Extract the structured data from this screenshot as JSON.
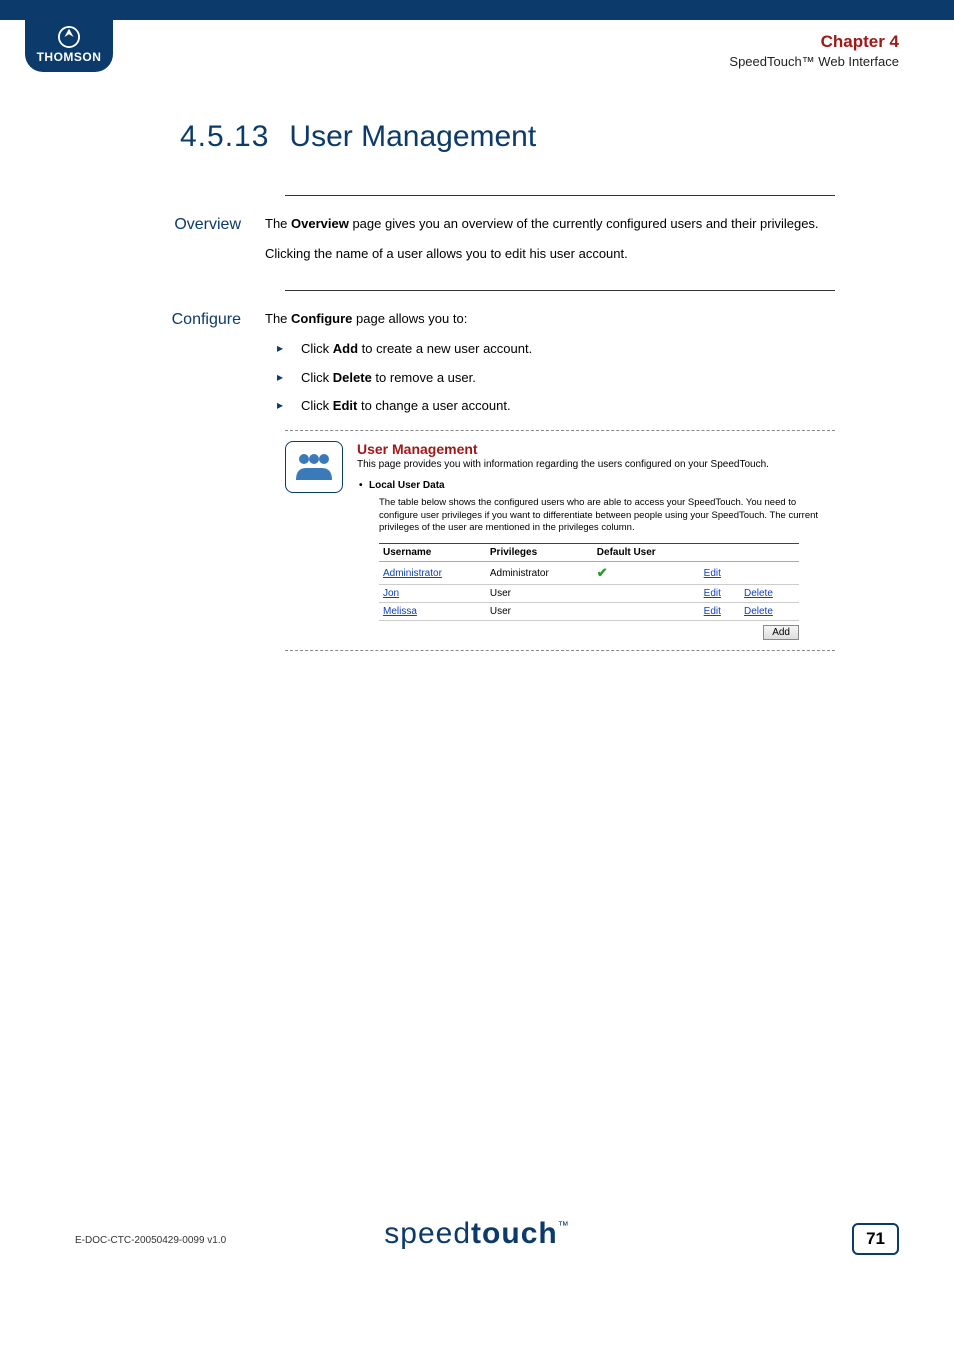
{
  "header": {
    "brand": "THOMSON",
    "chapter": "Chapter 4",
    "subtitle": "SpeedTouch™ Web Interface"
  },
  "title": {
    "number": "4.5.13",
    "text": "User Management"
  },
  "overview": {
    "heading": "Overview",
    "p1a": "The ",
    "p1b": "Overview",
    "p1c": " page gives you an overview of the currently configured users and their privileges.",
    "p2": "Clicking the name of a user allows you to edit his user account."
  },
  "configure": {
    "heading": "Configure",
    "intro_a": "The ",
    "intro_b": "Configure",
    "intro_c": " page allows you to:",
    "items": [
      {
        "pre": "Click ",
        "bold": "Add",
        "post": " to create a new user account."
      },
      {
        "pre": "Click ",
        "bold": "Delete",
        "post": " to remove a user."
      },
      {
        "pre": "Click ",
        "bold": "Edit",
        "post": " to change a user account."
      }
    ]
  },
  "ui": {
    "title": "User Management",
    "desc": "This page provides you with information regarding the users configured on your SpeedTouch.",
    "subhead": "Local User Data",
    "note": "The table below shows the configured users who are able to access your SpeedTouch. You need to configure user privileges if you want to differentiate between people using your SpeedTouch. The current privileges of the user are mentioned in the privileges column.",
    "columns": {
      "c1": "Username",
      "c2": "Privileges",
      "c3": "Default User"
    },
    "rows": [
      {
        "user": "Administrator",
        "priv": "Administrator",
        "default": true,
        "edit": "Edit",
        "del": ""
      },
      {
        "user": "Jon",
        "priv": "User",
        "default": false,
        "edit": "Edit",
        "del": "Delete"
      },
      {
        "user": "Melissa",
        "priv": "User",
        "default": false,
        "edit": "Edit",
        "del": "Delete"
      }
    ],
    "add": "Add"
  },
  "footer": {
    "brand1": "speed",
    "brand2": "touch",
    "tm": "™",
    "doc": "E-DOC-CTC-20050429-0099 v1.0",
    "page": "71"
  }
}
